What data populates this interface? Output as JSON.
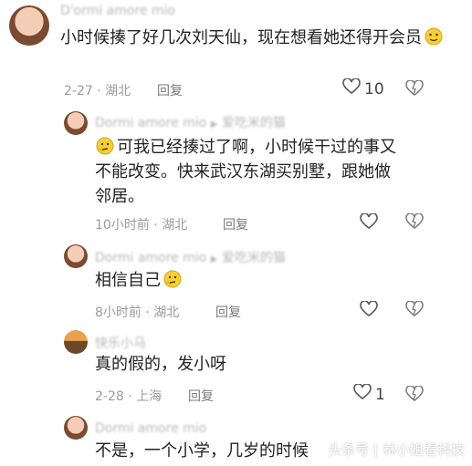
{
  "comments": [
    {
      "username": "D'ormi amore mio",
      "text": "小时候揍了好几次刘天仙，现在想看她还得开会员",
      "date": "2-27",
      "location": "湖北",
      "reply_label": "回复",
      "likes": "10"
    },
    {
      "username": "Dormi amore mio",
      "reply_to": "爱吃米的猫",
      "text": "可我已经揍过了啊，小时候干过的事又不能改变。快来武汉东湖买别墅，跟她做邻居。",
      "time": "10小时前",
      "location": "湖北",
      "reply_label": "回复"
    },
    {
      "username": "Dormi amore mio",
      "reply_to": "爱吃米的猫",
      "text": "相信自己",
      "time": "8小时前",
      "location": "湖北",
      "reply_label": "回复"
    },
    {
      "username": "快乐小马",
      "text": "真的假的，发小呀",
      "date": "2-28",
      "location": "上海",
      "reply_label": "回复",
      "likes": "1"
    },
    {
      "username": "Dormi amore mio",
      "text": "不是，一个小学，几岁的时候"
    }
  ],
  "watermark": "头条号 | 林小姐看科技",
  "colors": {
    "text": "#222222",
    "meta": "#9b9b9b",
    "username": "#b7b7b7"
  }
}
